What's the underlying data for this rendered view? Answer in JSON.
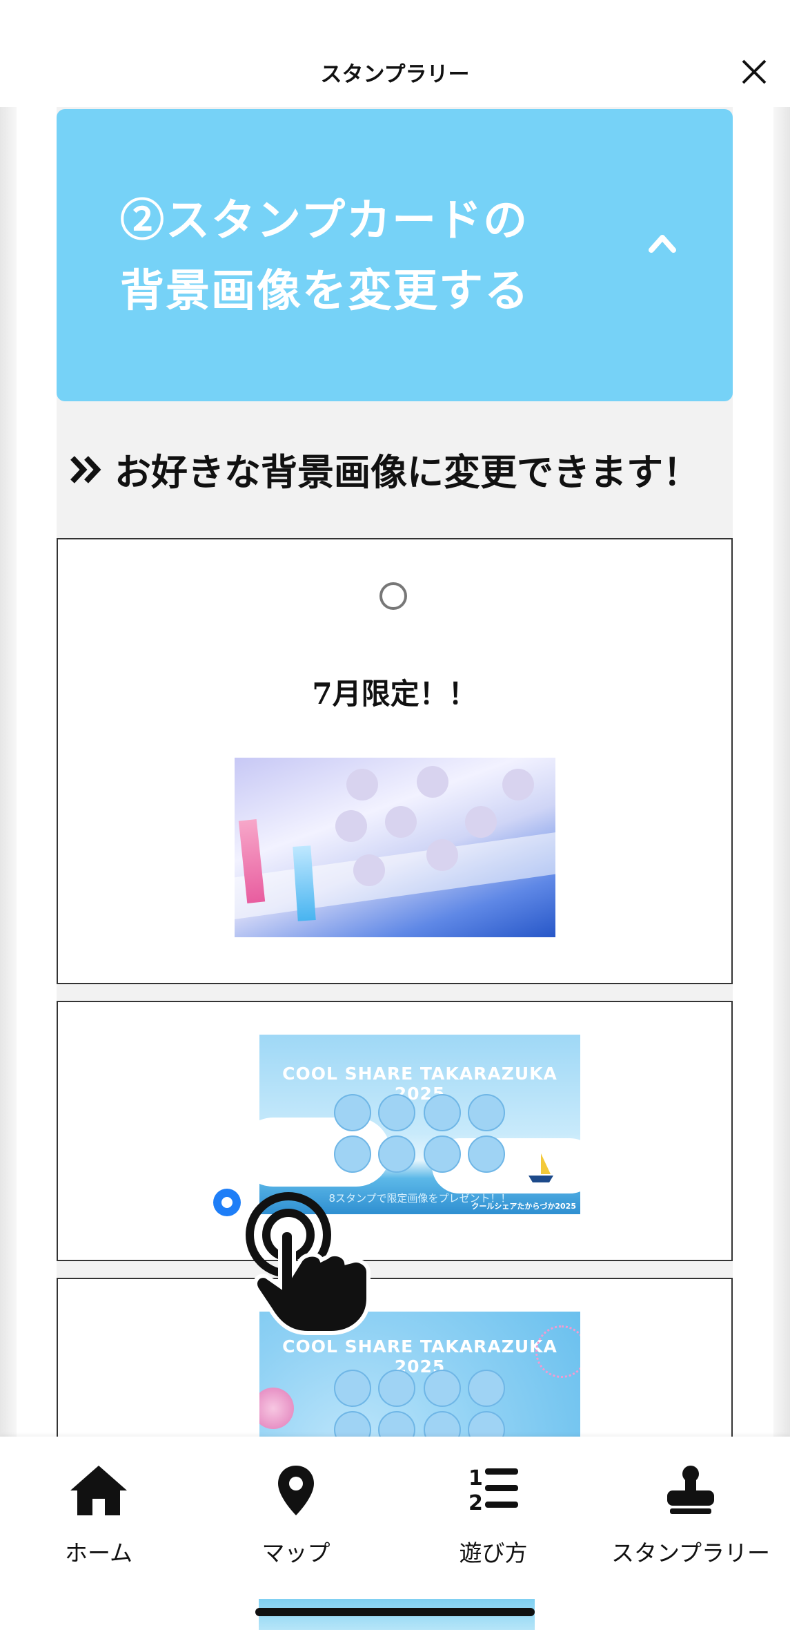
{
  "header": {
    "title": "スタンプラリー"
  },
  "accordion": {
    "line1": "②スタンプカードの",
    "line2": "背景画像を変更する"
  },
  "section": {
    "title": "お好きな背景画像に変更できます！"
  },
  "cards": [
    {
      "label": "7月限定！！",
      "selected": false
    },
    {
      "label": "",
      "selected": true,
      "thumb_title": "COOL SHARE TAKARAZUKA 2025",
      "thumb_caption": "8スタンプで限定画像をプレゼント！！",
      "thumb_brand": "クールシェアたからづか2025"
    },
    {
      "label": "",
      "selected": false,
      "thumb_title": "COOL SHARE TAKARAZUKA 2025"
    }
  ],
  "tabs": [
    {
      "label": "ホーム",
      "icon": "home-icon"
    },
    {
      "label": "マップ",
      "icon": "map-pin-icon"
    },
    {
      "label": "遊び方",
      "icon": "numbered-list-icon"
    },
    {
      "label": "スタンプラリー",
      "icon": "stamp-icon"
    }
  ],
  "colors": {
    "accordion": "#76d2f7",
    "radio_selected": "#1e7ef7"
  }
}
